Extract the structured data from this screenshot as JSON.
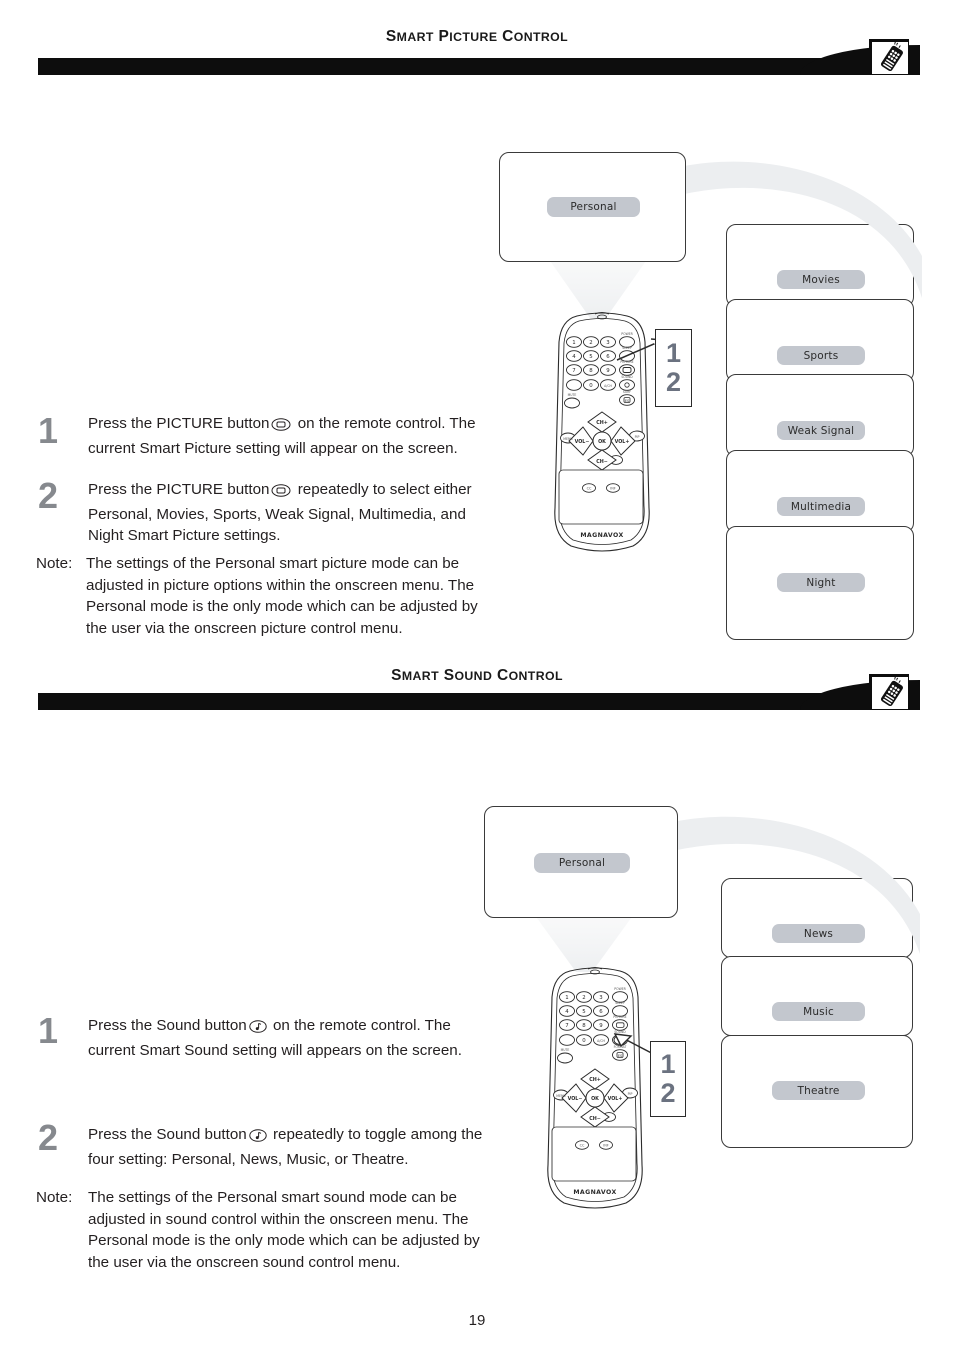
{
  "page": {
    "number": "19"
  },
  "sections": [
    {
      "id": "smart-picture-control",
      "title_parts": [
        {
          "t": "S",
          "cap": true
        },
        {
          "t": "MART",
          "cap": false
        },
        {
          "t": " P",
          "cap": true
        },
        {
          "t": "ICTURE",
          "cap": false
        },
        {
          "t": " C",
          "cap": true
        },
        {
          "t": "ONTROL",
          "cap": false
        }
      ],
      "title_plain": "SMART PICTURE CONTROL",
      "header_icon": "remote-control-icon",
      "osd_screen": {
        "chip_label": "Personal"
      },
      "menu_boxes": [
        {
          "label": "Movies"
        },
        {
          "label": "Sports"
        },
        {
          "label": "Weak Signal"
        },
        {
          "label": "Multimedia"
        },
        {
          "label": "Night"
        }
      ],
      "callout": {
        "line1": "1",
        "line2": "2"
      },
      "remote": {
        "brand": "MAGNAVOX",
        "highlight_button": "picture-button",
        "keypad": [
          "1",
          "2",
          "3",
          "4",
          "5",
          "6",
          "7",
          "8",
          "9"
        ],
        "labels_top": [
          "POWER",
          "SLEEP",
          "PICTURE",
          "SOUND",
          "SURF"
        ],
        "nav_labels": [
          "CH+",
          "VOL−",
          "OK",
          "VOL+",
          "CH−"
        ],
        "extra_buttons": [
          "CC",
          "INF"
        ]
      },
      "steps": [
        {
          "num": "1",
          "before": "Press the PICTURE button",
          "glyph": "picture-button-glyph",
          "after": " on the remote control. The current Smart Picture setting will appear on the screen."
        },
        {
          "num": "2",
          "before": "Press the PICTURE button",
          "glyph": "picture-button-glyph",
          "after": " repeatedly to select either Personal, Movies, Sports, Weak Signal, Multimedia, and Night Smart Picture settings."
        }
      ],
      "note": {
        "label": "Note:",
        "text": "The settings of the Personal smart picture mode can be adjusted in picture options within the onscreen menu. The Personal mode is the only mode which can be adjusted by the user via the onscreen picture control menu."
      }
    },
    {
      "id": "smart-sound-control",
      "title_parts": [
        {
          "t": "S",
          "cap": true
        },
        {
          "t": "MART",
          "cap": false
        },
        {
          "t": " S",
          "cap": true
        },
        {
          "t": "OUND",
          "cap": false
        },
        {
          "t": " C",
          "cap": true
        },
        {
          "t": "ONTROL",
          "cap": false
        }
      ],
      "title_plain": "SMART SOUND CONTROL",
      "header_icon": "remote-control-icon",
      "osd_screen": {
        "chip_label": "Personal"
      },
      "menu_boxes": [
        {
          "label": "News"
        },
        {
          "label": "Music"
        },
        {
          "label": "Theatre"
        }
      ],
      "callout": {
        "line1": "1",
        "line2": "2"
      },
      "remote": {
        "brand": "MAGNAVOX",
        "highlight_button": "sound-button",
        "keypad": [
          "1",
          "2",
          "3",
          "4",
          "5",
          "6",
          "7",
          "8",
          "9"
        ],
        "labels_top": [
          "POWER",
          "SLEEP",
          "PICTURE",
          "SOUND",
          "SURF"
        ],
        "nav_labels": [
          "CH+",
          "VOL−",
          "OK",
          "VOL+",
          "CH−"
        ],
        "extra_buttons": [
          "CC",
          "INF"
        ]
      },
      "steps": [
        {
          "num": "1",
          "before": "Press the Sound button",
          "glyph": "sound-button-glyph",
          "after": " on the remote control. The current Smart Sound setting will appears on the screen."
        },
        {
          "num": "2",
          "before": "Press the Sound button",
          "glyph": "sound-button-glyph",
          "after": " repeatedly to toggle among the four setting: Personal, News, Music, or Theatre."
        }
      ],
      "note": {
        "label": "Note:",
        "text": "The settings of the Personal smart sound mode can be adjusted in sound control within the onscreen menu. The Personal  mode is the only mode which can be adjusted by the user via the onscreen sound control menu."
      }
    }
  ],
  "colors": {
    "bar": "#0d0d0d",
    "chip": "#c3c7ce",
    "swoosh": "#eceef0",
    "step_number": "#86898e",
    "callout_number": "#6b7280",
    "box_border": "#3a3a3a"
  }
}
